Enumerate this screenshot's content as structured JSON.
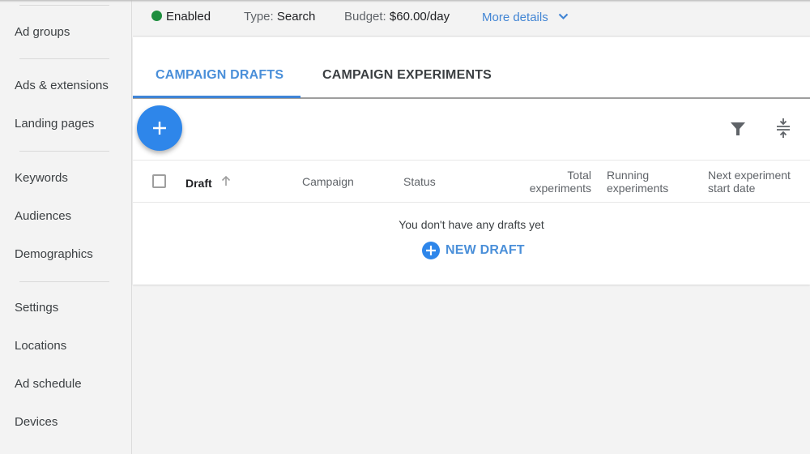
{
  "sidebar": {
    "items": [
      {
        "label": "Ad groups"
      },
      {
        "label": "Ads & extensions"
      },
      {
        "label": "Landing pages"
      },
      {
        "label": "Keywords"
      },
      {
        "label": "Audiences"
      },
      {
        "label": "Demographics"
      },
      {
        "label": "Settings"
      },
      {
        "label": "Locations"
      },
      {
        "label": "Ad schedule"
      },
      {
        "label": "Devices"
      }
    ]
  },
  "summary": {
    "status": "Enabled",
    "status_color": "#1e8e3e",
    "type_label": "Type:",
    "type_value": "Search",
    "budget_label": "Budget:",
    "budget_value": "$60.00/day",
    "more_details": "More details"
  },
  "tabs": [
    {
      "label": "CAMPAIGN DRAFTS",
      "active": true
    },
    {
      "label": "CAMPAIGN EXPERIMENTS",
      "active": false
    }
  ],
  "toolbar": {
    "add_icon": "plus-icon",
    "filter_icon": "filter-icon",
    "density_icon": "compact-rows-icon"
  },
  "table": {
    "columns": {
      "draft": "Draft",
      "campaign": "Campaign",
      "status": "Status",
      "total_l1": "Total",
      "total_l2": "experiments",
      "running_l1": "Running",
      "running_l2": "experiments",
      "next_l1": "Next experiment",
      "next_l2": "start date"
    },
    "sort": "ascending",
    "rows": []
  },
  "empty_state": {
    "message": "You don't have any drafts yet",
    "action": "NEW DRAFT"
  },
  "colors": {
    "accent": "#4a8fd9",
    "fab": "#2e86ea"
  }
}
